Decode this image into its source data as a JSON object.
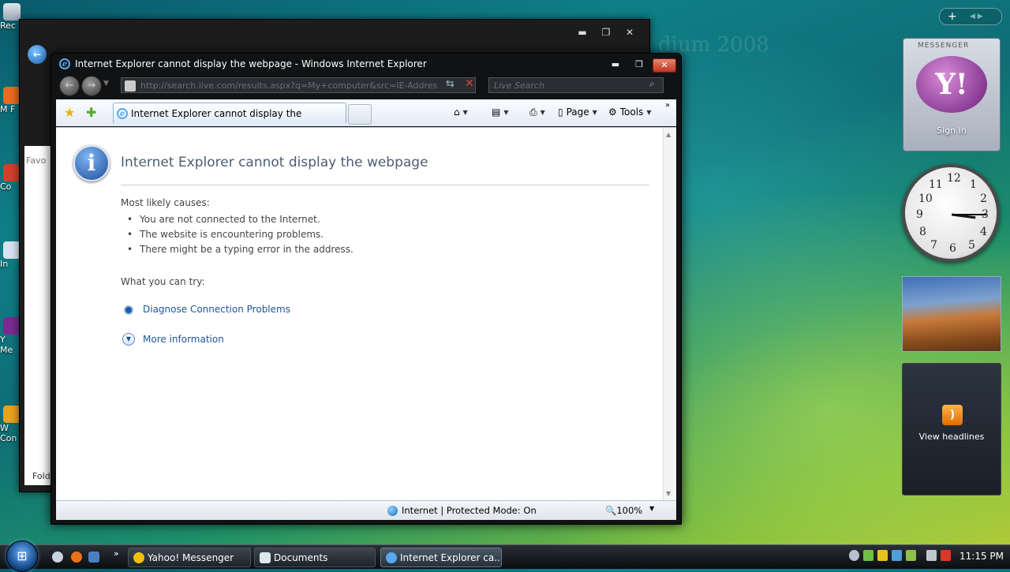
{
  "desktop": {
    "icons": [
      {
        "label": "Rec"
      },
      {
        "label": "M F"
      },
      {
        "label": "Co"
      },
      {
        "label": "In"
      },
      {
        "label": "Y Me"
      },
      {
        "label": "W Con"
      }
    ],
    "watermark": "dium 2008"
  },
  "background_window": {
    "favorites_label": "Favo",
    "folders_label": "Fold",
    "buttons": {
      "minimize": "▬",
      "maximize": "❐",
      "close": "✕"
    }
  },
  "ie_window": {
    "title": "Internet Explorer cannot display the webpage - Windows Internet Explorer",
    "buttons": {
      "minimize": "▬",
      "maximize": "❐",
      "close": "✕"
    },
    "address": "http://search.live.com/results.aspx?q=My+computer&src=IE-Addres",
    "search_placeholder": "Live Search",
    "tab_title": "Internet Explorer cannot display the webpage",
    "commands": {
      "page": "Page",
      "tools": "Tools"
    },
    "content": {
      "heading": "Internet Explorer cannot display the webpage",
      "causes_label": "Most likely causes:",
      "causes": [
        "You are not connected to the Internet.",
        "The website is encountering problems.",
        "There might be a typing error in the address."
      ],
      "try_label": "What you can try:",
      "diagnose_link": "Diagnose Connection Problems",
      "more_info": "More information"
    },
    "status": {
      "zone": "Internet | Protected Mode: On",
      "zoom": "100%"
    }
  },
  "sidebar": {
    "messenger": {
      "brand": "MESSENGER",
      "logo": "Y!",
      "sign_in": "Sign In"
    },
    "clock": {
      "hour": 3,
      "minute": 15
    },
    "feeds": {
      "label": "View headlines"
    }
  },
  "taskbar": {
    "start": "⊞",
    "buttons": [
      {
        "label": "Yahoo! Messenger"
      },
      {
        "label": "Documents"
      },
      {
        "label": "Internet Explorer ca..."
      }
    ],
    "time": "11:15 PM"
  },
  "colors": {
    "link": "#1f5597",
    "heading": "#4b5d73",
    "close_red": "#c0341e"
  }
}
